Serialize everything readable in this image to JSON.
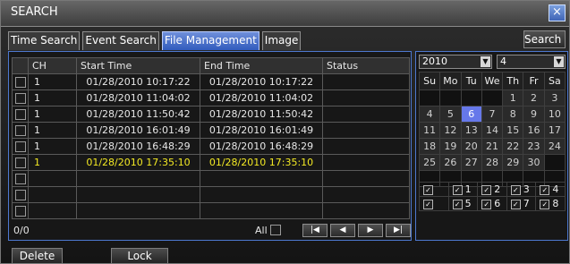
{
  "window": {
    "title": "SEARCH",
    "close_icon": "×"
  },
  "tabs": [
    {
      "label": "Time Search"
    },
    {
      "label": "Event Search"
    },
    {
      "label": "File Management"
    },
    {
      "label": "Image"
    }
  ],
  "search_button": "Search",
  "table": {
    "headers": [
      "CH",
      "Start Time",
      "End Time",
      "Status"
    ],
    "rows": [
      {
        "ch": "1",
        "start": "01/28/2010 10:17:22",
        "end": "01/28/2010 10:17:22",
        "status": ""
      },
      {
        "ch": "1",
        "start": "01/28/2010 11:04:02",
        "end": "01/28/2010 11:04:02",
        "status": ""
      },
      {
        "ch": "1",
        "start": "01/28/2010 11:50:42",
        "end": "01/28/2010 11:50:42",
        "status": ""
      },
      {
        "ch": "1",
        "start": "01/28/2010 16:01:49",
        "end": "01/28/2010 16:01:49",
        "status": ""
      },
      {
        "ch": "1",
        "start": "01/28/2010 16:48:29",
        "end": "01/28/2010 16:48:29",
        "status": ""
      },
      {
        "ch": "1",
        "start": "01/28/2010 17:35:10",
        "end": "01/28/2010 17:35:10",
        "status": ""
      }
    ],
    "count": "0/0",
    "all_label": "All"
  },
  "nav": {
    "first": "|◀",
    "prev": "◀",
    "next": "▶",
    "last": "▶|"
  },
  "buttons": {
    "delete": "Delete",
    "lock": "Lock"
  },
  "calendar": {
    "year": "2010",
    "month": "4",
    "weekdays": [
      "Su",
      "Mo",
      "Tu",
      "We",
      "Th",
      "Fr",
      "Sa"
    ],
    "days": [
      "1",
      "2",
      "3",
      "4",
      "5",
      "6",
      "7",
      "8",
      "9",
      "10",
      "11",
      "12",
      "13",
      "14",
      "15",
      "16",
      "17",
      "18",
      "19",
      "20",
      "21",
      "22",
      "23",
      "24",
      "25",
      "26",
      "27",
      "28",
      "29",
      "30"
    ],
    "selected_day": "6"
  },
  "channels": [
    "1",
    "2",
    "3",
    "4",
    "5",
    "6",
    "7",
    "8"
  ],
  "colors": {
    "accent": "#4d78cf",
    "highlight": "#f4ea24",
    "selected_day": "#6678ea"
  }
}
